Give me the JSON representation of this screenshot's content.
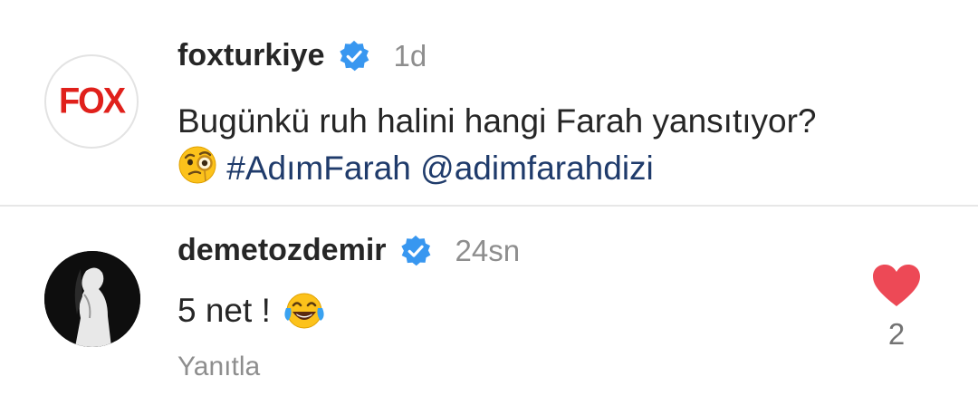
{
  "post": {
    "avatar_logo_text": "FOX",
    "username": "foxturkiye",
    "verified_icon": "verified-badge-icon",
    "time": "1d",
    "caption_text": "Bugünkü ruh halini hangi Farah yansıtıyor?",
    "caption_emoji_icon": "face-with-monocle-emoji",
    "hashtag": "#AdımFarah",
    "mention": "@adimfarahdizi"
  },
  "comment": {
    "username": "demetozdemir",
    "verified_icon": "verified-badge-icon",
    "time": "24sn",
    "text": "5 net !",
    "emoji_icon": "face-with-tears-of-joy-emoji",
    "reply_label": "Yanıtla",
    "like_icon": "heart-filled-icon",
    "like_count": "2"
  },
  "colors": {
    "verified": "#3897f0",
    "link": "#1f3b6b",
    "heart": "#ed4956",
    "fox_red": "#e0201b",
    "muted": "#8e8e8e"
  }
}
